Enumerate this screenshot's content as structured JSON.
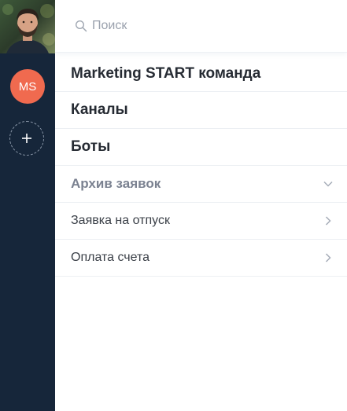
{
  "rail": {
    "team_initials": "MS",
    "add_symbol": "+"
  },
  "search": {
    "placeholder": "Поиск",
    "icon": "search-icon"
  },
  "team": {
    "name": "Marketing START команда"
  },
  "nav": {
    "channels": "Каналы",
    "bots": "Боты"
  },
  "archive": {
    "label": "Архив заявок",
    "icon": "chevron-down-icon",
    "items": [
      {
        "label": "Заявка на отпуск",
        "icon": "chevron-right-icon"
      },
      {
        "label": "Оплата счета",
        "icon": "chevron-right-icon"
      }
    ]
  },
  "colors": {
    "rail_bg": "#16263a",
    "team_avatar_bg": "#f06a4f"
  }
}
